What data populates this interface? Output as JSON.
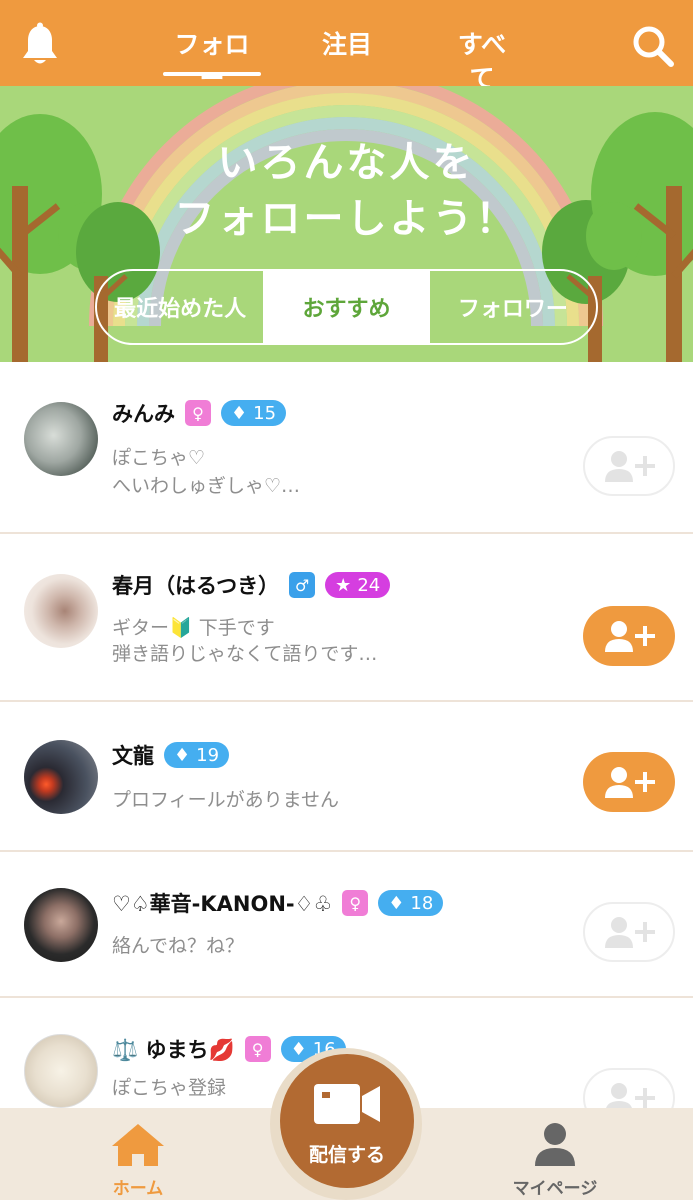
{
  "header": {
    "tabs": [
      {
        "label": "フォロー",
        "active": true
      },
      {
        "label": "注目",
        "active": false
      },
      {
        "label": "すべて",
        "active": false
      }
    ],
    "bell_icon": "bell-icon",
    "search_icon": "search-icon"
  },
  "banner": {
    "title_line1": "いろんな人を",
    "title_line2": "フォローしよう！",
    "segments": [
      {
        "label": "最近始めた人",
        "active": false
      },
      {
        "label": "おすすめ",
        "active": true
      },
      {
        "label": "フォロワー",
        "active": false
      }
    ]
  },
  "users": [
    {
      "name": "みんみ",
      "gender": "female",
      "gender_symbol": "♀",
      "level_icon": "diamond",
      "level_symbol": "♦",
      "level": "15",
      "bio1": "ぽこちゃ♡",
      "bio2": "へいわしゅぎしゃ♡…",
      "followed": false
    },
    {
      "name": "春月（はるつき）",
      "gender": "male",
      "gender_symbol": "♂",
      "level_icon": "star",
      "level_symbol": "★",
      "level": "24",
      "bio1": "ギター🔰 下手です",
      "bio2": "弾き語りじゃなくて語りです…",
      "followed": true
    },
    {
      "name": "文龍",
      "gender": "",
      "gender_symbol": "",
      "level_icon": "diamond",
      "level_symbol": "♦",
      "level": "19",
      "bio1": "プロフィールがありません",
      "bio2": "",
      "followed": true
    },
    {
      "name": "♡♤華音-KANON-♢♧",
      "gender": "female",
      "gender_symbol": "♀",
      "level_icon": "diamond",
      "level_symbol": "♦",
      "level": "18",
      "bio1": "絡んでね？ね？",
      "bio2": "",
      "followed": false
    },
    {
      "name": "⚖️ ゆまち💋",
      "gender": "female",
      "gender_symbol": "♀",
      "level_icon": "diamond",
      "level_symbol": "♦",
      "level": "16",
      "bio1": "ぽこちゃ登録",
      "bio2": "",
      "followed": false
    }
  ],
  "bottom_nav": {
    "home_label": "ホーム",
    "broadcast_label": "配信する",
    "mypage_label": "マイページ"
  },
  "colors": {
    "accent": "#ef9a3f",
    "banner_green": "#a9d77a",
    "broadcast": "#b26a32"
  }
}
